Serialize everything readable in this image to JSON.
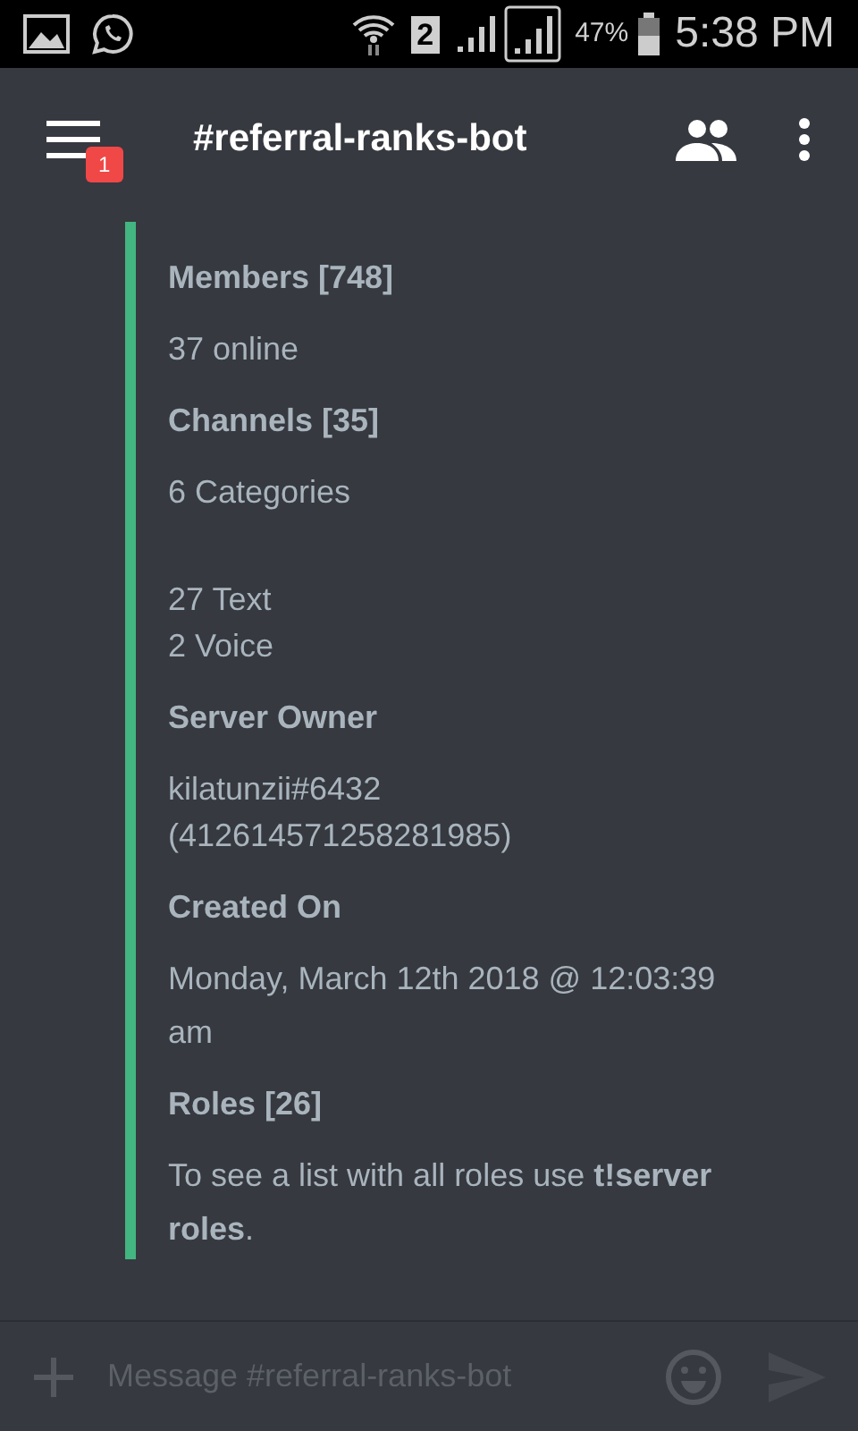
{
  "status_bar": {
    "sim_slot": "2",
    "battery": "47%",
    "time": "5:38 PM"
  },
  "header": {
    "title": "#referral-ranks-bot",
    "menu_badge": "1"
  },
  "embed": {
    "fields": [
      {
        "name": "Members [748]",
        "groups": [
          [
            "37 online"
          ]
        ]
      },
      {
        "name": "Channels [35]",
        "groups": [
          [
            "6 Categories"
          ],
          [
            "27 Text",
            "2 Voice"
          ]
        ]
      },
      {
        "name": "Server Owner",
        "groups": [
          [
            "kilatunzii#6432",
            "(412614571258281985)"
          ]
        ]
      },
      {
        "name": "Created On",
        "groups": [
          [
            "Monday, March 12th 2018 @ 12:03:39 am"
          ]
        ]
      },
      {
        "name": "Roles [26]",
        "groups": [
          [
            "To see a list with all roles use **t!server roles**."
          ]
        ]
      }
    ]
  },
  "composer": {
    "placeholder": "Message #referral-ranks-bot"
  }
}
